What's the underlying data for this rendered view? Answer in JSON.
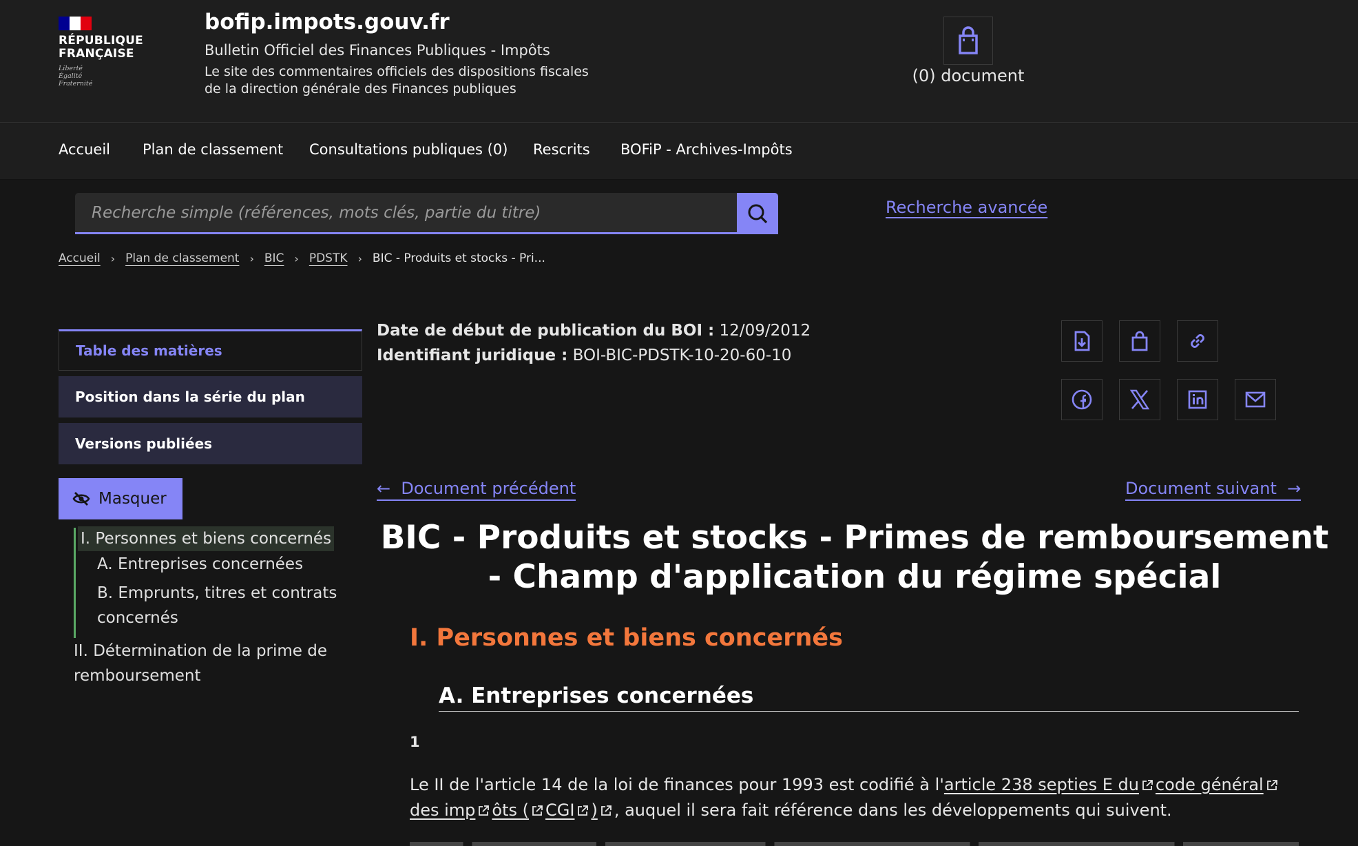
{
  "header": {
    "logo": {
      "line1": "RÉPUBLIQUE",
      "line2": "FRANÇAISE",
      "motto1": "Liberté",
      "motto2": "Égalité",
      "motto3": "Fraternité"
    },
    "site_title": "bofip.impots.gouv.fr",
    "subtitle": "Bulletin Officiel des Finances Publiques - Impôts",
    "tagline": "Le site des commentaires officiels des dispositions fiscales de la direction générale des Finances publiques",
    "basket_label": "(0) document"
  },
  "nav": {
    "items": [
      "Accueil",
      "Plan de classement",
      "Consultations publiques (0)",
      "Rescrits",
      "BOFiP - Archives-Impôts"
    ]
  },
  "search": {
    "placeholder": "Recherche simple (références, mots clés, partie du titre)",
    "advanced": "Recherche avancée"
  },
  "breadcrumb": {
    "items": [
      "Accueil",
      "Plan de classement",
      "BIC",
      "PDSTK"
    ],
    "current": "BIC - Produits et stocks - Pri..."
  },
  "sidebar": {
    "tabs": [
      "Table des matières",
      "Position dans la série du plan",
      "Versions publiées"
    ],
    "hide_label": "Masquer",
    "toc": [
      "I. Personnes et biens concernés",
      "A. Entreprises concernées",
      "B. Emprunts, titres et contrats",
      "concernés",
      "II. Détermination de la prime de",
      "remboursement"
    ]
  },
  "meta": {
    "pub_label": "Date de début de publication du BOI :",
    "pub_value": "12/09/2012",
    "id_label": "Identifiant juridique :",
    "id_value": "BOI-BIC-PDSTK-10-20-60-10"
  },
  "doc_nav": {
    "prev": "Document précédent",
    "next": "Document suivant"
  },
  "content": {
    "title": "BIC - Produits et stocks - Primes de remboursement - Champ d'application du régime spécial",
    "section": "I. Personnes et biens concernés",
    "subsection": "A. Entreprises concernées",
    "para_num": "1",
    "para_text1": "Le II de l'article 14 de la loi de finances pour 1993 est codifié à l'",
    "link1": "article 238 septies E du",
    "link2": "code général",
    "link3": "des imp",
    "link4": "ôts (",
    "link5": "CGI",
    "link6": ")",
    "para_text2": ", auquel il sera fait référence dans les développements qui suivent."
  },
  "colors": {
    "accent": "#8585f6",
    "section": "#f3773c",
    "toc_bar": "#5aaa65",
    "flag_blue": "#000091",
    "flag_red": "#e1000f"
  },
  "icons": [
    "basket-icon",
    "search-icon",
    "download-icon",
    "link-icon",
    "facebook-icon",
    "x-icon",
    "linkedin-icon",
    "mail-icon",
    "eye-off-icon",
    "arrow-left-icon",
    "arrow-right-icon",
    "external-link-icon"
  ]
}
